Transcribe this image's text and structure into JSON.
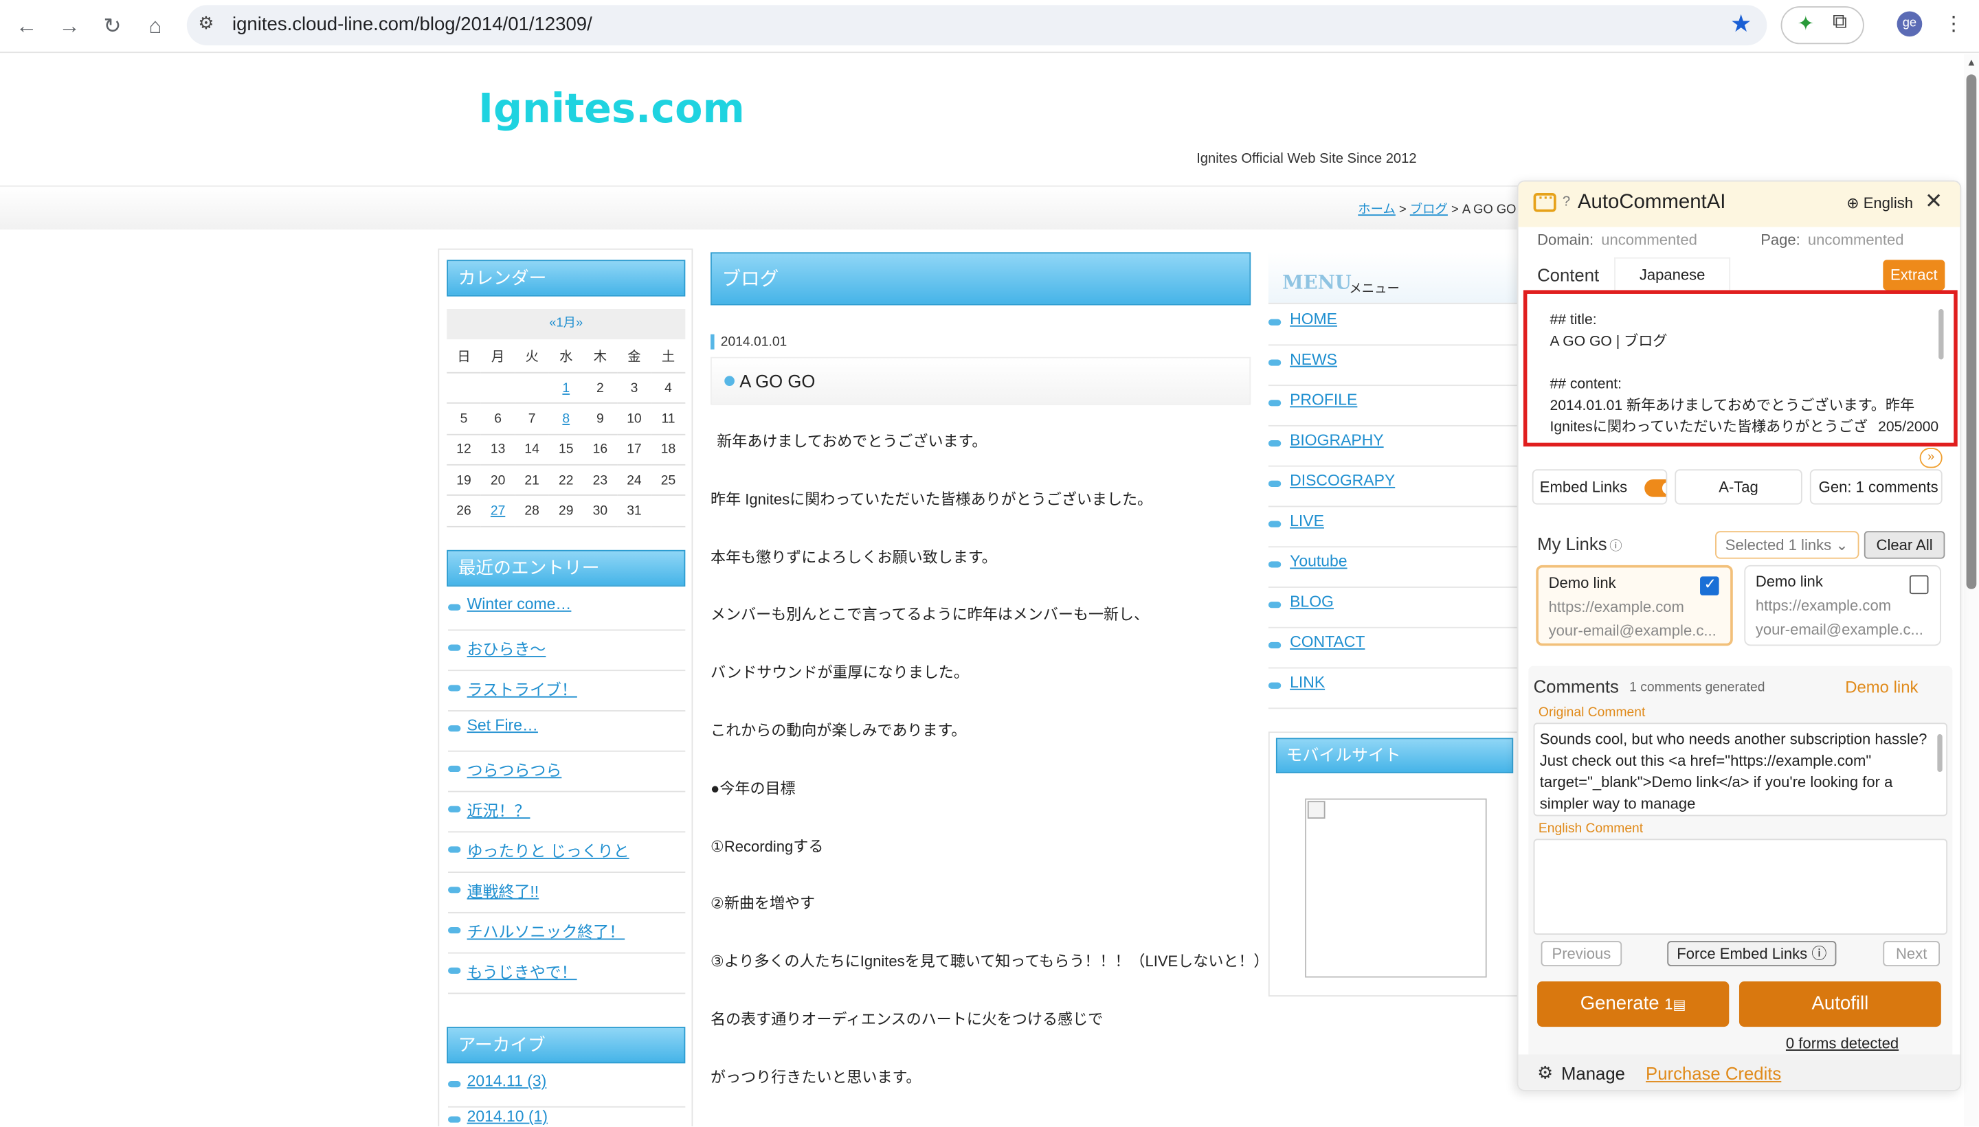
{
  "browser": {
    "url": "ignites.cloud-line.com/blog/2014/01/12309/",
    "avatar": "ge"
  },
  "site": {
    "title": "Ignites.com",
    "tagline": "Ignites Official Web Site Since 2012",
    "breadcrumb": [
      "ホーム",
      "ブログ",
      "A GO GO"
    ]
  },
  "calendar": {
    "heading": "カレンダー",
    "caption": "«1月»",
    "weekdays": [
      "日",
      "月",
      "火",
      "水",
      "木",
      "金",
      "土"
    ],
    "rows": [
      [
        "",
        "",
        "",
        "1",
        "2",
        "3",
        "4"
      ],
      [
        "5",
        "6",
        "7",
        "8",
        "9",
        "10",
        "11"
      ],
      [
        "12",
        "13",
        "14",
        "15",
        "16",
        "17",
        "18"
      ],
      [
        "19",
        "20",
        "21",
        "22",
        "23",
        "24",
        "25"
      ],
      [
        "26",
        "27",
        "28",
        "29",
        "30",
        "31",
        ""
      ]
    ],
    "linked_days": [
      "1",
      "8",
      "27"
    ]
  },
  "recent": {
    "heading": "最近のエントリー",
    "items": [
      "Winter come…",
      "おひらき～",
      "ラストライブ！",
      "Set Fire…",
      "つらつらつら",
      "近況！？",
      "ゆったりと じっくりと",
      "連戦終了!!",
      "チハルソニック終了！",
      "もうじきやで！"
    ]
  },
  "archive": {
    "heading": "アーカイブ",
    "items": [
      "2014.11 (3)",
      "2014.10 (1)"
    ]
  },
  "blog": {
    "heading": "ブログ",
    "date": "2014.01.01",
    "title": "A GO GO",
    "paragraphs": [
      "新年あけましておめでとうございます。",
      "昨年 Ignitesに関わっていただいた皆様ありがとうございました。",
      "本年も懲りずによろしくお願い致します。",
      "メンバーも別んとこで言ってるように昨年はメンバーも一新し、",
      "バンドサウンドが重厚になりました。",
      "これからの動向が楽しみであります。",
      "●今年の目標",
      "①Recordingする",
      "②新曲を増やす",
      "③より多くの人たちにIgnitesを見て聴いて知ってもらう！！！（LIVEしないと！）",
      "名の表す通りオーディエンスのハートに火をつける感じで",
      "がっつり行きたいと思います。"
    ]
  },
  "menu": {
    "heading_en": "MENU",
    "heading_jp": "メニュー",
    "items": [
      "HOME",
      "NEWS",
      "PROFILE",
      "BIOGRAPHY",
      "DISCOGRAPY",
      "LIVE",
      "Youtube",
      "BLOG",
      "CONTACT",
      "LINK"
    ],
    "mobile_heading": "モバイルサイト"
  },
  "panel": {
    "name": "AutoCommentAI",
    "language": "English",
    "domain_label": "Domain:",
    "domain_value": "uncommented",
    "page_label": "Page:",
    "page_value": "uncommented",
    "content_label": "Content",
    "content_tab": "Japanese",
    "extract": "Extract",
    "content_text": "## title:\nA GO GO | ブログ\n\n## content:\n2014.01.01 新年あけましておめでとうございます。昨年\nIgnitesに関わっていただいた皆様ありがとうござ",
    "char_count": "205/2000",
    "embed_links": "Embed Links",
    "atag": "A-Tag",
    "gen": "Gen: 1 comments",
    "my_links": "My Links",
    "selected_links": "Selected 1 links",
    "clear_all": "Clear All",
    "links": [
      {
        "name": "Demo link",
        "url": "https://example.com",
        "email": "your-email@example.c...",
        "checked": true
      },
      {
        "name": "Demo link",
        "url": "https://example.com",
        "email": "your-email@example.c...",
        "checked": false
      }
    ],
    "comments_title": "Comments",
    "comments_generated": "1 comments generated",
    "comments_link": "Demo link",
    "original_label": "Original Comment",
    "original_text": "Sounds cool, but who needs another subscription hassle? Just check out this <a href=\"https://example.com\" target=\"_blank\">Demo link</a> if you're looking for a simpler way to manage",
    "english_label": "English Comment",
    "english_text": "",
    "previous": "Previous",
    "force_embed": "Force Embed Links",
    "next": "Next",
    "generate": "Generate",
    "generate_credits": "1",
    "autofill": "Autofill",
    "forms_detected": "0 forms detected",
    "manage": "Manage",
    "purchase": "Purchase Credits",
    "accent": "#ee8a1a"
  }
}
